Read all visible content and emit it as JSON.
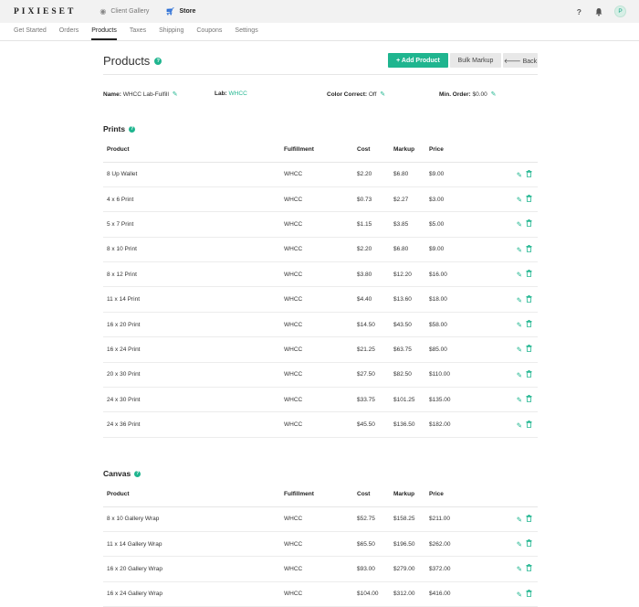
{
  "topbar": {
    "logo": "PIXIESET",
    "links": [
      {
        "label": "Client Gallery",
        "icon": "camera-icon"
      },
      {
        "label": "Store",
        "icon": "cart-icon"
      }
    ],
    "help": "?",
    "avatar": "P"
  },
  "subnav": [
    "Get Started",
    "Orders",
    "Products",
    "Taxes",
    "Shipping",
    "Coupons",
    "Settings"
  ],
  "subnav_active": "Products",
  "header": {
    "title": "Products",
    "add_label": "+ Add Product",
    "bulk_label": "Bulk Markup",
    "back_label": "🡐 Back"
  },
  "meta": {
    "name_key": "Name:",
    "name_val": "WHCC Lab-Fulfill",
    "lab_key": "Lab:",
    "lab_val": "WHCC",
    "color_key": "Color Correct:",
    "color_val": "Off",
    "min_key": "Min. Order:",
    "min_val": "$0.00"
  },
  "columns": [
    "Product",
    "Fulfillment",
    "Cost",
    "Markup",
    "Price"
  ],
  "prints": {
    "title": "Prints",
    "rows": [
      [
        "8 Up Wallet",
        "WHCC",
        "$2.20",
        "$6.80",
        "$9.00"
      ],
      [
        "4 x 6 Print",
        "WHCC",
        "$0.73",
        "$2.27",
        "$3.00"
      ],
      [
        "5 x 7 Print",
        "WHCC",
        "$1.15",
        "$3.85",
        "$5.00"
      ],
      [
        "8 x 10 Print",
        "WHCC",
        "$2.20",
        "$6.80",
        "$9.00"
      ],
      [
        "8 x 12 Print",
        "WHCC",
        "$3.80",
        "$12.20",
        "$16.00"
      ],
      [
        "11 x 14 Print",
        "WHCC",
        "$4.40",
        "$13.60",
        "$18.00"
      ],
      [
        "16 x 20 Print",
        "WHCC",
        "$14.50",
        "$43.50",
        "$58.00"
      ],
      [
        "16 x 24 Print",
        "WHCC",
        "$21.25",
        "$63.75",
        "$85.00"
      ],
      [
        "20 x 30 Print",
        "WHCC",
        "$27.50",
        "$82.50",
        "$110.00"
      ],
      [
        "24 x 30 Print",
        "WHCC",
        "$33.75",
        "$101.25",
        "$135.00"
      ],
      [
        "24 x 36 Print",
        "WHCC",
        "$45.50",
        "$136.50",
        "$182.00"
      ]
    ]
  },
  "canvas": {
    "title": "Canvas",
    "rows": [
      [
        "8 x 10 Gallery Wrap",
        "WHCC",
        "$52.75",
        "$158.25",
        "$211.00"
      ],
      [
        "11 x 14 Gallery Wrap",
        "WHCC",
        "$65.50",
        "$196.50",
        "$262.00"
      ],
      [
        "16 x 20 Gallery Wrap",
        "WHCC",
        "$93.00",
        "$279.00",
        "$372.00"
      ],
      [
        "16 x 24 Gallery Wrap",
        "WHCC",
        "$104.00",
        "$312.00",
        "$416.00"
      ]
    ]
  },
  "colors": {
    "accent": "#1fb58f",
    "store_icon": "#2b6fd6"
  }
}
